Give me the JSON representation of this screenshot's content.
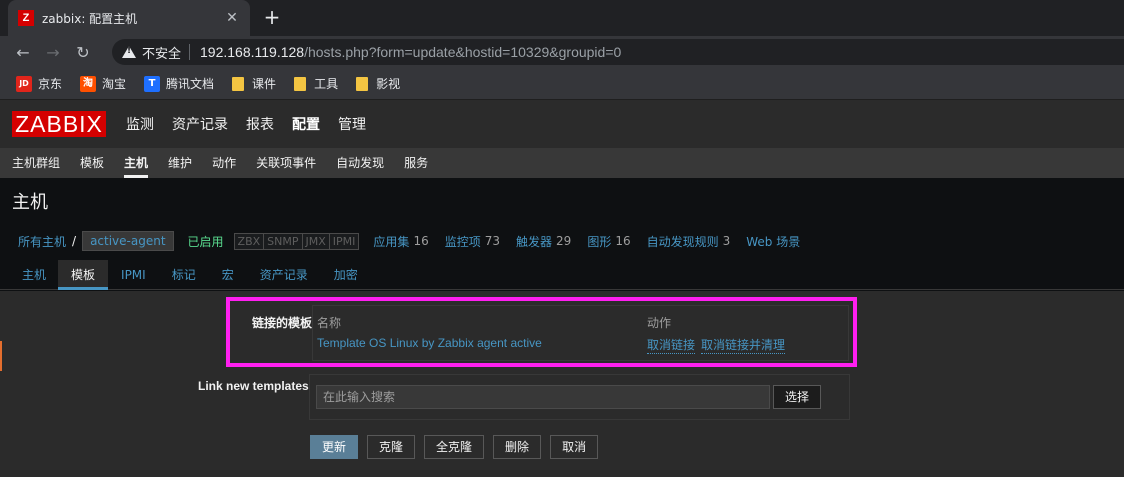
{
  "browser": {
    "tab_title": "zabbix: 配置主机",
    "tab_favicon": "Z",
    "insecure_label": "不安全",
    "url_host": "192.168.119.128",
    "url_path": "/hosts.php?form=update&hostid=10329&groupid=0",
    "bookmarks": [
      {
        "label": "京东",
        "icon": "JD"
      },
      {
        "label": "淘宝",
        "icon": "淘"
      },
      {
        "label": "腾讯文档",
        "icon": "T"
      },
      {
        "label": "课件",
        "icon": "folder"
      },
      {
        "label": "工具",
        "icon": "folder"
      },
      {
        "label": "影视",
        "icon": "folder"
      }
    ]
  },
  "zabbix": {
    "logo": "ZABBIX",
    "main_menu": [
      "监测",
      "资产记录",
      "报表",
      "配置",
      "管理"
    ],
    "sub_menu": [
      "主机群组",
      "模板",
      "主机",
      "维护",
      "动作",
      "关联项事件",
      "自动发现",
      "服务"
    ],
    "page_title": "主机",
    "breadcrumb": {
      "all_hosts": "所有主机",
      "slash": "/",
      "current": "active-agent",
      "status": "已启用",
      "availability": [
        "ZBX",
        "SNMP",
        "JMX",
        "IPMI"
      ],
      "items": [
        {
          "label": "应用集",
          "count": "16"
        },
        {
          "label": "监控项",
          "count": "73"
        },
        {
          "label": "触发器",
          "count": "29"
        },
        {
          "label": "图形",
          "count": "16"
        },
        {
          "label": "自动发现规则",
          "count": "3"
        },
        {
          "label": "Web 场景",
          "count": ""
        }
      ]
    },
    "tabs": [
      "主机",
      "模板",
      "IPMI",
      "标记",
      "宏",
      "资产记录",
      "加密"
    ],
    "form": {
      "linked_label": "链接的模板",
      "col_name": "名称",
      "col_action": "动作",
      "template_name": "Template OS Linux by Zabbix agent active",
      "unlink": "取消链接",
      "unlink_clear": "取消链接并清理",
      "link_new_label": "Link new templates",
      "search_placeholder": "在此输入搜索",
      "select_btn": "选择",
      "buttons": [
        "更新",
        "克隆",
        "全克隆",
        "删除",
        "取消"
      ]
    }
  },
  "colors": {
    "brand": "#d40000",
    "highlight_box": "#ff1ff0",
    "link": "#4796c4",
    "enabled": "#59db8f"
  }
}
